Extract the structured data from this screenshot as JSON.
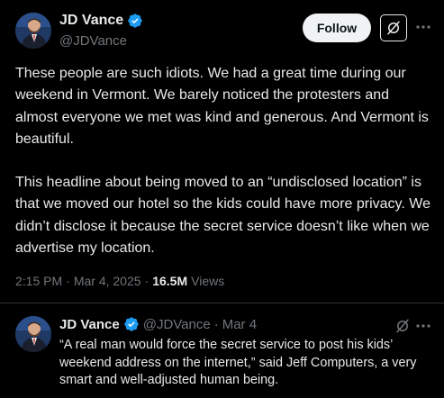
{
  "post": {
    "author_name": "JD Vance",
    "handle": "@JDVance",
    "follow_label": "Follow",
    "paragraphs": [
      "These people are such idiots. We had a great time during our weekend in Vermont. We barely noticed the protesters and almost everyone we met was kind and generous. And Vermont is beautiful.",
      "This headline about being moved to an “undisclosed location” is that we moved our hotel so the kids could have more privacy. We didn’t disclose it because the secret service doesn’t like when we advertise my location."
    ],
    "time": "2:15 PM",
    "date": "Mar 4, 2025",
    "separator": "·",
    "views_count": "16.5M",
    "views_label": "Views"
  },
  "quote": {
    "author_name": "JD Vance",
    "handle": "@JDVance",
    "separator": "·",
    "date": "Mar 4",
    "text": "“A real man would force the secret service to post his kids’ weekend address on the internet,” said Jeff Computers, a very smart and well-adjusted human being."
  },
  "icons": {
    "verified": "verified-badge-icon",
    "grok": "grok-icon",
    "more": "more-icon"
  },
  "colors": {
    "background": "#000000",
    "text": "#e7e9ea",
    "secondary": "#71767b",
    "verified": "#1d9bf0",
    "follow_bg": "#eff3f4",
    "divider": "#2f3336"
  }
}
